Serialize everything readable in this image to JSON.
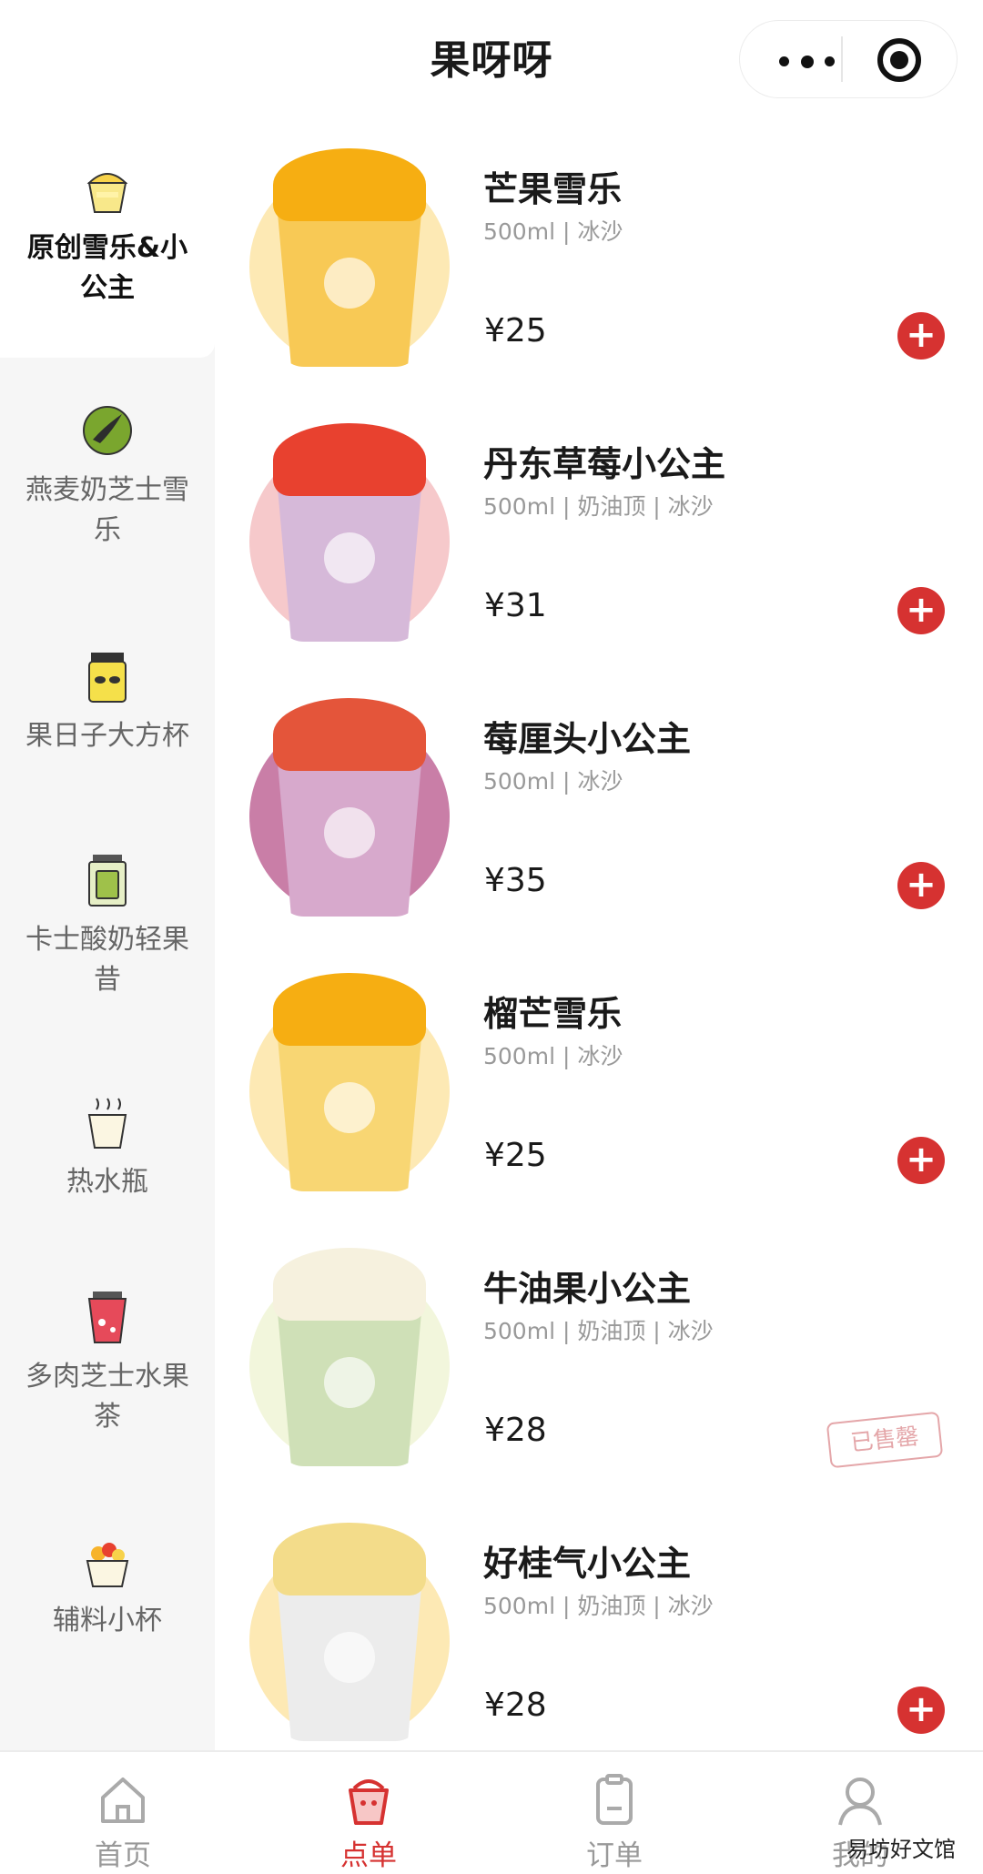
{
  "app": {
    "title": "果呀呀"
  },
  "sidebar": {
    "items": [
      {
        "label": "原创雪乐&小公主",
        "icon": "dessert-cup-icon",
        "active": true
      },
      {
        "label": "燕麦奶芝士雪乐",
        "icon": "bird-icon",
        "active": false
      },
      {
        "label": "果日子大方杯",
        "icon": "square-cup-icon",
        "active": false
      },
      {
        "label": "卡士酸奶轻果昔",
        "icon": "yogurt-jar-icon",
        "active": false
      },
      {
        "label": "热水瓶",
        "icon": "hot-cup-icon",
        "active": false
      },
      {
        "label": "多肉芝士水果茶",
        "icon": "fruit-tea-icon",
        "active": false
      },
      {
        "label": "辅料小杯",
        "icon": "topping-cup-icon",
        "active": false
      }
    ]
  },
  "products": [
    {
      "name": "芒果雪乐",
      "spec": "500ml | 冰沙",
      "price": "¥25",
      "action": "+",
      "sold_out": false,
      "circle_color": "#fde9b4",
      "cup_color": "#f8c955",
      "top_color": "#f6ae12"
    },
    {
      "name": "丹东草莓小公主",
      "spec": "500ml | 奶油顶 | 冰沙",
      "price": "¥31",
      "action": "+",
      "sold_out": false,
      "circle_color": "#f6c9cb",
      "cup_color": "#d6b9d9",
      "top_color": "#e8412f"
    },
    {
      "name": "莓厘头小公主",
      "spec": "500ml | 冰沙",
      "price": "¥35",
      "action": "+",
      "sold_out": false,
      "circle_color": "#c97ea7",
      "cup_color": "#d7a9cc",
      "top_color": "#e4553a"
    },
    {
      "name": "榴芒雪乐",
      "spec": "500ml | 冰沙",
      "price": "¥25",
      "action": "+",
      "sold_out": false,
      "circle_color": "#fde9b4",
      "cup_color": "#f8d673",
      "top_color": "#f6ae12"
    },
    {
      "name": "牛油果小公主",
      "spec": "500ml | 奶油顶 | 冰沙",
      "price": "¥28",
      "sold_out_text": "已售罄",
      "sold_out": true,
      "circle_color": "#f2f6dc",
      "cup_color": "#cfe0b7",
      "top_color": "#f6f1de"
    },
    {
      "name": "好桂气小公主",
      "spec": "500ml | 奶油顶 | 冰沙",
      "price": "¥28",
      "action": "+",
      "sold_out": false,
      "circle_color": "#fde9b4",
      "cup_color": "#ececec",
      "top_color": "#f3dc8a"
    }
  ],
  "tabbar": {
    "tabs": [
      {
        "label": "首页",
        "icon": "home-icon",
        "active": false
      },
      {
        "label": "点单",
        "icon": "order-cup-icon",
        "active": true
      },
      {
        "label": "订单",
        "icon": "clipboard-icon",
        "active": false
      },
      {
        "label": "我的",
        "icon": "user-icon",
        "active": false
      }
    ]
  },
  "watermark": "易坊好文馆",
  "colors": {
    "accent": "#d63231",
    "sidebar_bg": "#f6f6f6",
    "sold_out": "#e4a6a9"
  }
}
